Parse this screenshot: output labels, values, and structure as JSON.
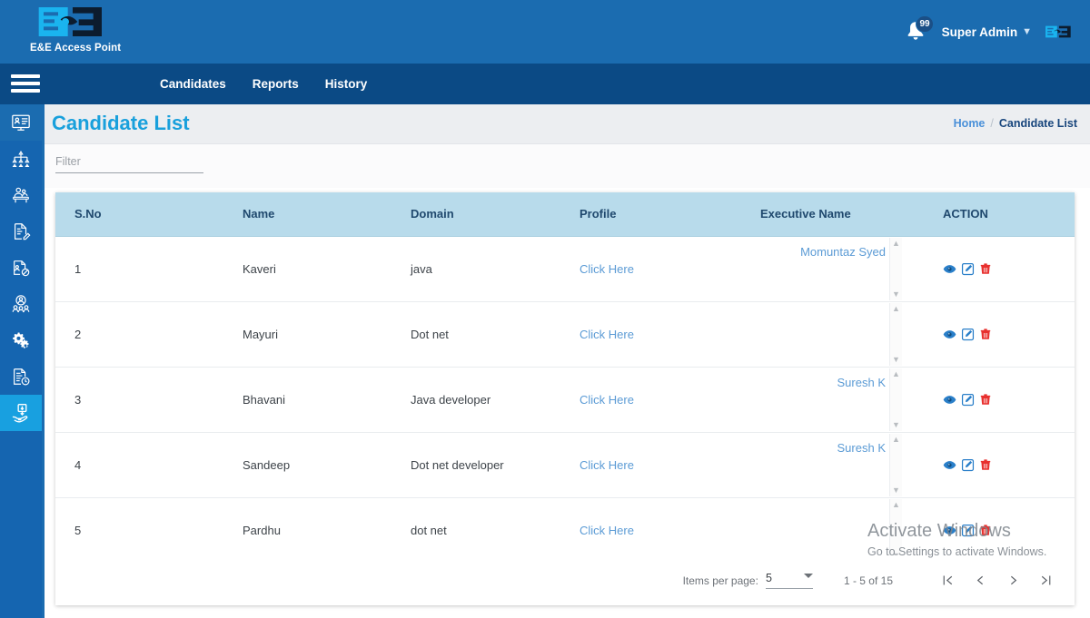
{
  "colors": {
    "topbar": "#1b6cb0",
    "navbar": "#0b4a85",
    "sidebar": "#1565b0",
    "sidebar_active": "#18a0e0",
    "title_blue": "#19a0dc",
    "table_header": "#b8dbeb",
    "link_blue": "#5b9bd5",
    "delete_red": "#e8312f"
  },
  "header": {
    "brand_logo_icon": "ee-access-point-logo-icon",
    "brand_name": "E&E Access Point",
    "notification_icon": "bell-icon",
    "notification_count": "99",
    "user_name": "Super Admin",
    "user_chevron_icon": "chevron-down-icon",
    "avatar_icon": "user-avatar-logo-icon"
  },
  "nav": {
    "menu_toggle_icon": "hamburger-menu-icon",
    "links": [
      {
        "label": "Candidates"
      },
      {
        "label": "Reports"
      },
      {
        "label": "History"
      }
    ]
  },
  "sidebar": {
    "items": [
      {
        "icon": "dashboard-monitor-icon",
        "state": "top-active"
      },
      {
        "icon": "org-hierarchy-icon",
        "state": ""
      },
      {
        "icon": "employee-desk-icon",
        "state": ""
      },
      {
        "icon": "document-edit-icon",
        "state": ""
      },
      {
        "icon": "document-block-icon",
        "state": ""
      },
      {
        "icon": "people-group-icon",
        "state": ""
      },
      {
        "icon": "settings-gears-icon",
        "state": ""
      },
      {
        "icon": "document-clock-icon",
        "state": ""
      },
      {
        "icon": "hand-receive-icon",
        "state": "active"
      }
    ]
  },
  "page": {
    "title": "Candidate List",
    "breadcrumb": {
      "home": "Home",
      "separator": "/",
      "current": "Candidate List"
    },
    "filter": {
      "placeholder": "Filter",
      "value": ""
    }
  },
  "table": {
    "columns": [
      {
        "label": "S.No"
      },
      {
        "label": "Name"
      },
      {
        "label": "Domain"
      },
      {
        "label": "Profile"
      },
      {
        "label": "Executive Name"
      },
      {
        "label": "ACTION"
      }
    ],
    "rows": [
      {
        "sno": "1",
        "name": "Kaveri",
        "domain": "java",
        "profile": "Click Here",
        "executive": "Momuntaz Syed"
      },
      {
        "sno": "2",
        "name": "Mayuri",
        "domain": "Dot net",
        "profile": "Click Here",
        "executive": ""
      },
      {
        "sno": "3",
        "name": "Bhavani",
        "domain": "Java developer",
        "profile": "Click Here",
        "executive": "Suresh K"
      },
      {
        "sno": "4",
        "name": "Sandeep",
        "domain": "Dot net developer",
        "profile": "Click Here",
        "executive": "Suresh K"
      },
      {
        "sno": "5",
        "name": "Pardhu",
        "domain": "dot net",
        "profile": "Click Here",
        "executive": ""
      }
    ],
    "action_icons": {
      "view": "eye-icon",
      "edit": "edit-pencil-icon",
      "delete": "trash-icon"
    },
    "scroll_up_icon": "caret-up-icon",
    "scroll_down_icon": "caret-down-icon"
  },
  "paginator": {
    "items_per_page_label": "Items per page:",
    "items_per_page_value": "5",
    "dropdown_icon": "chevron-down-icon",
    "range_label": "1 - 5 of 15",
    "first_page_icon": "first-page-icon",
    "prev_page_icon": "previous-page-icon",
    "next_page_icon": "next-page-icon",
    "last_page_icon": "last-page-icon"
  },
  "watermark": {
    "line1": "Activate Windows",
    "line2": "Go to Settings to activate Windows."
  }
}
